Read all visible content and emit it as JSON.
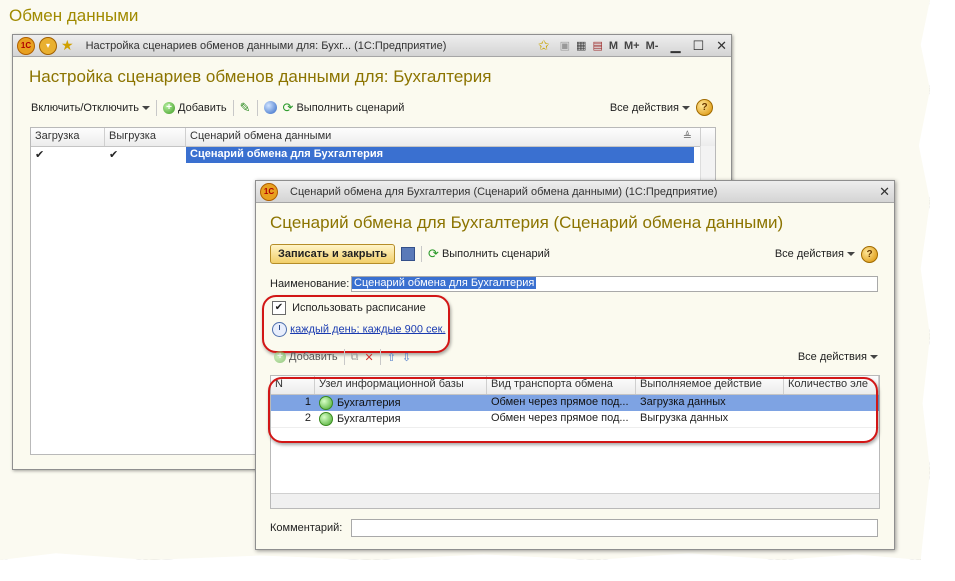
{
  "page": {
    "title": "Обмен данными"
  },
  "window1": {
    "title": "Настройка сценариев обменов данными для: Бухг...  (1С:Предприятие)",
    "form_title": "Настройка сценариев обменов данными для: Бухгалтерия",
    "toolbar": {
      "toggle_label": "Включить/Отключить",
      "add_label": "Добавить",
      "run_label": "Выполнить сценарий",
      "all_actions": "Все действия"
    },
    "titlebar_right": {
      "m": "M",
      "mplus": "M+",
      "mminus": "M-"
    },
    "table": {
      "headers": [
        "Загрузка",
        "Выгрузка",
        "Сценарий обмена данными"
      ],
      "rows": [
        {
          "load": "✔",
          "unload": "✔",
          "scenario": "Сценарий обмена для Бухгалтерия"
        }
      ]
    }
  },
  "window2": {
    "title": "Сценарий обмена для Бухгалтерия (Сценарий обмена данными)  (1С:Предприятие)",
    "form_title": "Сценарий обмена для Бухгалтерия (Сценарий обмена данными)",
    "toolbar": {
      "save_close": "Записать и закрыть",
      "run_label": "Выполнить сценарий",
      "all_actions": "Все действия"
    },
    "name_label": "Наименование:",
    "name_value": "Сценарий обмена для Бухгалтерия",
    "use_schedule_label": "Использовать расписание",
    "use_schedule_checked": "✔",
    "schedule_link": "каждый день; каждые 900 сек.",
    "sub_toolbar": {
      "add_label": "Добавить",
      "all_actions": "Все действия"
    },
    "table": {
      "headers": [
        "N",
        "Узел информационной базы",
        "Вид транспорта обмена",
        "Выполняемое действие",
        "Количество эле"
      ],
      "rows": [
        {
          "n": "1",
          "node": "Бухгалтерия",
          "transport": "Обмен через прямое под...",
          "action": "Загрузка данных"
        },
        {
          "n": "2",
          "node": "Бухгалтерия",
          "transport": "Обмен через прямое под...",
          "action": "Выгрузка данных"
        }
      ]
    },
    "comment_label": "Комментарий:"
  },
  "colors": {
    "accent_title": "#8c7400",
    "selection": "#7ea3e3",
    "highlight_oval": "#d21616"
  }
}
